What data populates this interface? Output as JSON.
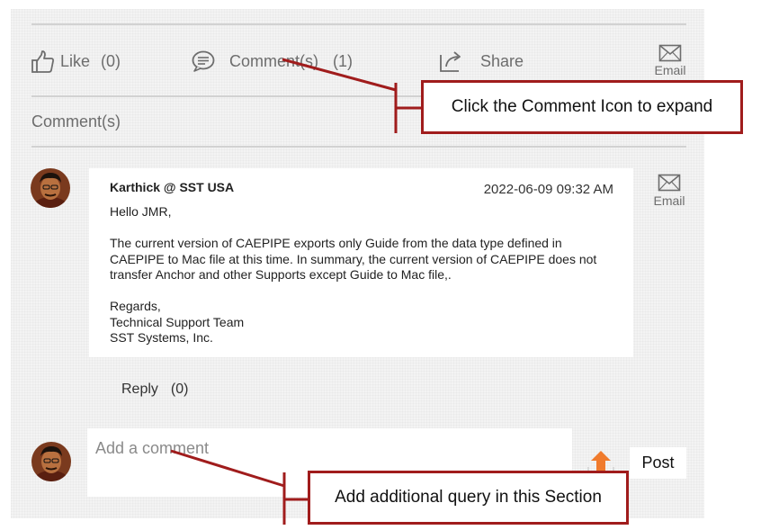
{
  "actions": {
    "like_label": "Like",
    "like_count": "(0)",
    "comment_label": "Comment(s)",
    "comment_count": "(1)",
    "share_label": "Share",
    "email_label": "Email"
  },
  "comments_heading": "Comment(s)",
  "comment": {
    "author": "Karthick @ SST USA",
    "date": "2022-06-09 09:32 AM",
    "greeting": "Hello JMR,",
    "paragraph": "The current version of CAEPIPE exports only Guide from the data type defined in CAEPIPE to Mac file at this time. In summary, the current version of CAEPIPE does not transfer Anchor and other Supports except Guide to Mac file,.",
    "signoff_1": "Regards,",
    "signoff_2": "Technical Support Team",
    "signoff_3": "SST Systems, Inc.",
    "email_label": "Email",
    "reply_label": "Reply",
    "reply_count": "(0)"
  },
  "new_comment": {
    "placeholder": "Add a comment",
    "post_label": "Post"
  },
  "annotations": {
    "comment_icon_callout": "Click the Comment Icon to expand",
    "add_query_callout": "Add additional query in this Section"
  },
  "colors": {
    "annotation": "#a01c1c",
    "upload_accent": "#f07b2d",
    "muted_text": "#6d6d6d"
  },
  "icons": [
    "like-icon",
    "comment-icon",
    "share-icon",
    "email-icon",
    "upload-icon",
    "avatar"
  ]
}
